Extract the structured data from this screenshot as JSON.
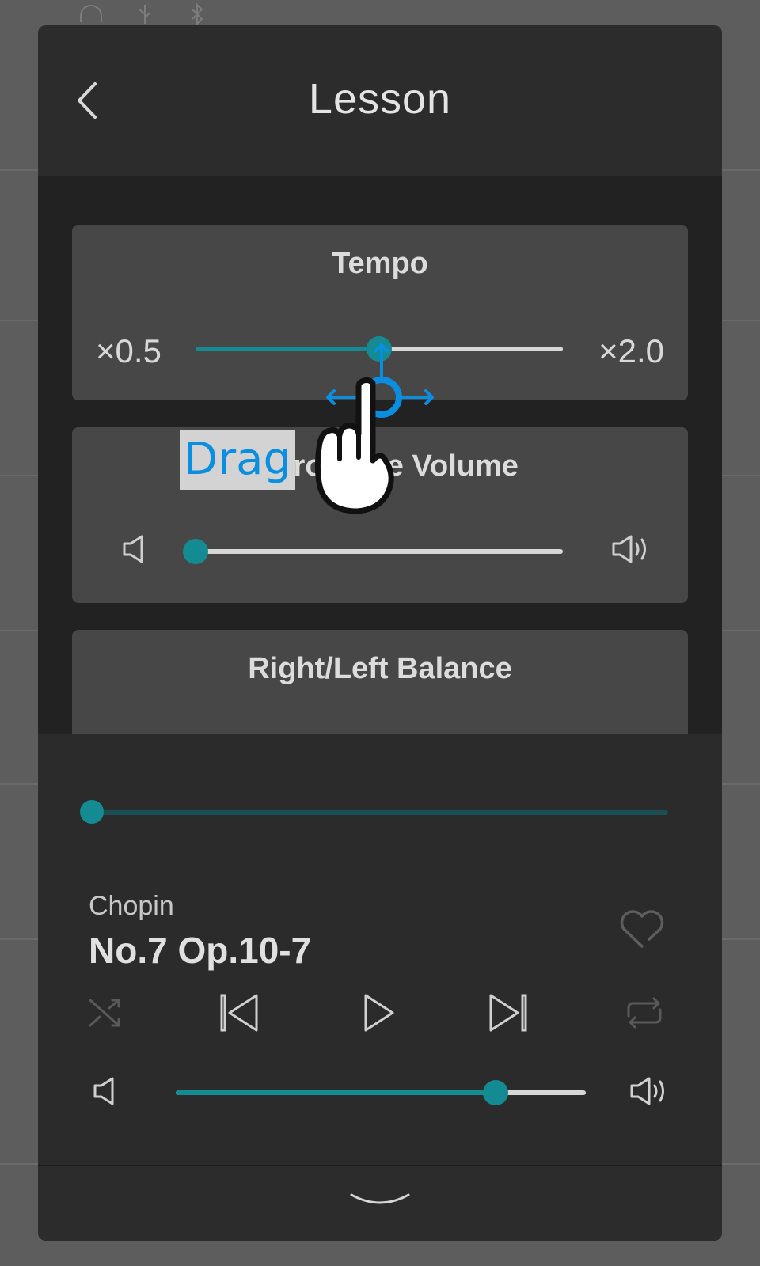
{
  "header": {
    "title": "Lesson",
    "back_icon": "chevron-left-icon"
  },
  "tempo": {
    "title": "Tempo",
    "min_label": "×0.5",
    "max_label": "×2.0",
    "value_fraction": 0.5
  },
  "metronome": {
    "title": "Metronome Volume",
    "value_fraction": 0.0,
    "icons": [
      "volume-low-icon",
      "volume-high-icon"
    ]
  },
  "balance": {
    "title": "Right/Left Balance"
  },
  "player": {
    "progress_fraction": 0.0,
    "composer": "Chopin",
    "piece": "No.7 Op.10-7",
    "volume_fraction": 0.78,
    "controls": [
      "shuffle-icon",
      "previous-track-icon",
      "play-icon",
      "next-track-icon",
      "repeat-icon"
    ],
    "favorite_icon": "heart-icon"
  },
  "footer": {
    "collapse_icon": "chevron-down-icon"
  },
  "overlay": {
    "hint_label": "Drag",
    "gesture": "drag-gesture-icon"
  },
  "colors": {
    "accent": "#148a92",
    "card": "#474747",
    "panel": "#2b2b2b",
    "hint": "#0a8fe0"
  }
}
